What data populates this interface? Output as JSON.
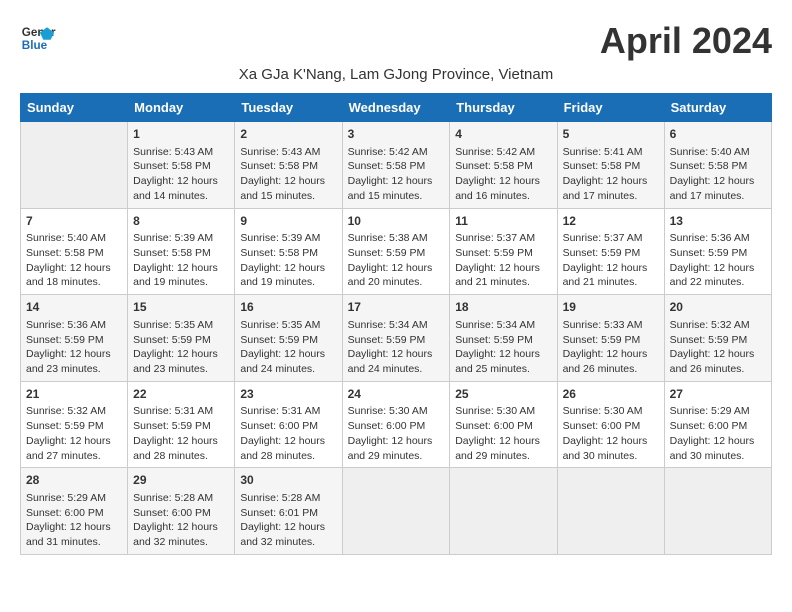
{
  "logo": {
    "line1": "General",
    "line2": "Blue"
  },
  "title": "April 2024",
  "subtitle": "Xa GJa K'Nang, Lam GJong Province, Vietnam",
  "headers": [
    "Sunday",
    "Monday",
    "Tuesday",
    "Wednesday",
    "Thursday",
    "Friday",
    "Saturday"
  ],
  "weeks": [
    [
      {
        "day": "",
        "info": ""
      },
      {
        "day": "1",
        "info": "Sunrise: 5:43 AM\nSunset: 5:58 PM\nDaylight: 12 hours\nand 14 minutes."
      },
      {
        "day": "2",
        "info": "Sunrise: 5:43 AM\nSunset: 5:58 PM\nDaylight: 12 hours\nand 15 minutes."
      },
      {
        "day": "3",
        "info": "Sunrise: 5:42 AM\nSunset: 5:58 PM\nDaylight: 12 hours\nand 15 minutes."
      },
      {
        "day": "4",
        "info": "Sunrise: 5:42 AM\nSunset: 5:58 PM\nDaylight: 12 hours\nand 16 minutes."
      },
      {
        "day": "5",
        "info": "Sunrise: 5:41 AM\nSunset: 5:58 PM\nDaylight: 12 hours\nand 17 minutes."
      },
      {
        "day": "6",
        "info": "Sunrise: 5:40 AM\nSunset: 5:58 PM\nDaylight: 12 hours\nand 17 minutes."
      }
    ],
    [
      {
        "day": "7",
        "info": "Sunrise: 5:40 AM\nSunset: 5:58 PM\nDaylight: 12 hours\nand 18 minutes."
      },
      {
        "day": "8",
        "info": "Sunrise: 5:39 AM\nSunset: 5:58 PM\nDaylight: 12 hours\nand 19 minutes."
      },
      {
        "day": "9",
        "info": "Sunrise: 5:39 AM\nSunset: 5:58 PM\nDaylight: 12 hours\nand 19 minutes."
      },
      {
        "day": "10",
        "info": "Sunrise: 5:38 AM\nSunset: 5:59 PM\nDaylight: 12 hours\nand 20 minutes."
      },
      {
        "day": "11",
        "info": "Sunrise: 5:37 AM\nSunset: 5:59 PM\nDaylight: 12 hours\nand 21 minutes."
      },
      {
        "day": "12",
        "info": "Sunrise: 5:37 AM\nSunset: 5:59 PM\nDaylight: 12 hours\nand 21 minutes."
      },
      {
        "day": "13",
        "info": "Sunrise: 5:36 AM\nSunset: 5:59 PM\nDaylight: 12 hours\nand 22 minutes."
      }
    ],
    [
      {
        "day": "14",
        "info": "Sunrise: 5:36 AM\nSunset: 5:59 PM\nDaylight: 12 hours\nand 23 minutes."
      },
      {
        "day": "15",
        "info": "Sunrise: 5:35 AM\nSunset: 5:59 PM\nDaylight: 12 hours\nand 23 minutes."
      },
      {
        "day": "16",
        "info": "Sunrise: 5:35 AM\nSunset: 5:59 PM\nDaylight: 12 hours\nand 24 minutes."
      },
      {
        "day": "17",
        "info": "Sunrise: 5:34 AM\nSunset: 5:59 PM\nDaylight: 12 hours\nand 24 minutes."
      },
      {
        "day": "18",
        "info": "Sunrise: 5:34 AM\nSunset: 5:59 PM\nDaylight: 12 hours\nand 25 minutes."
      },
      {
        "day": "19",
        "info": "Sunrise: 5:33 AM\nSunset: 5:59 PM\nDaylight: 12 hours\nand 26 minutes."
      },
      {
        "day": "20",
        "info": "Sunrise: 5:32 AM\nSunset: 5:59 PM\nDaylight: 12 hours\nand 26 minutes."
      }
    ],
    [
      {
        "day": "21",
        "info": "Sunrise: 5:32 AM\nSunset: 5:59 PM\nDaylight: 12 hours\nand 27 minutes."
      },
      {
        "day": "22",
        "info": "Sunrise: 5:31 AM\nSunset: 5:59 PM\nDaylight: 12 hours\nand 28 minutes."
      },
      {
        "day": "23",
        "info": "Sunrise: 5:31 AM\nSunset: 6:00 PM\nDaylight: 12 hours\nand 28 minutes."
      },
      {
        "day": "24",
        "info": "Sunrise: 5:30 AM\nSunset: 6:00 PM\nDaylight: 12 hours\nand 29 minutes."
      },
      {
        "day": "25",
        "info": "Sunrise: 5:30 AM\nSunset: 6:00 PM\nDaylight: 12 hours\nand 29 minutes."
      },
      {
        "day": "26",
        "info": "Sunrise: 5:30 AM\nSunset: 6:00 PM\nDaylight: 12 hours\nand 30 minutes."
      },
      {
        "day": "27",
        "info": "Sunrise: 5:29 AM\nSunset: 6:00 PM\nDaylight: 12 hours\nand 30 minutes."
      }
    ],
    [
      {
        "day": "28",
        "info": "Sunrise: 5:29 AM\nSunset: 6:00 PM\nDaylight: 12 hours\nand 31 minutes."
      },
      {
        "day": "29",
        "info": "Sunrise: 5:28 AM\nSunset: 6:00 PM\nDaylight: 12 hours\nand 32 minutes."
      },
      {
        "day": "30",
        "info": "Sunrise: 5:28 AM\nSunset: 6:01 PM\nDaylight: 12 hours\nand 32 minutes."
      },
      {
        "day": "",
        "info": ""
      },
      {
        "day": "",
        "info": ""
      },
      {
        "day": "",
        "info": ""
      },
      {
        "day": "",
        "info": ""
      }
    ]
  ]
}
